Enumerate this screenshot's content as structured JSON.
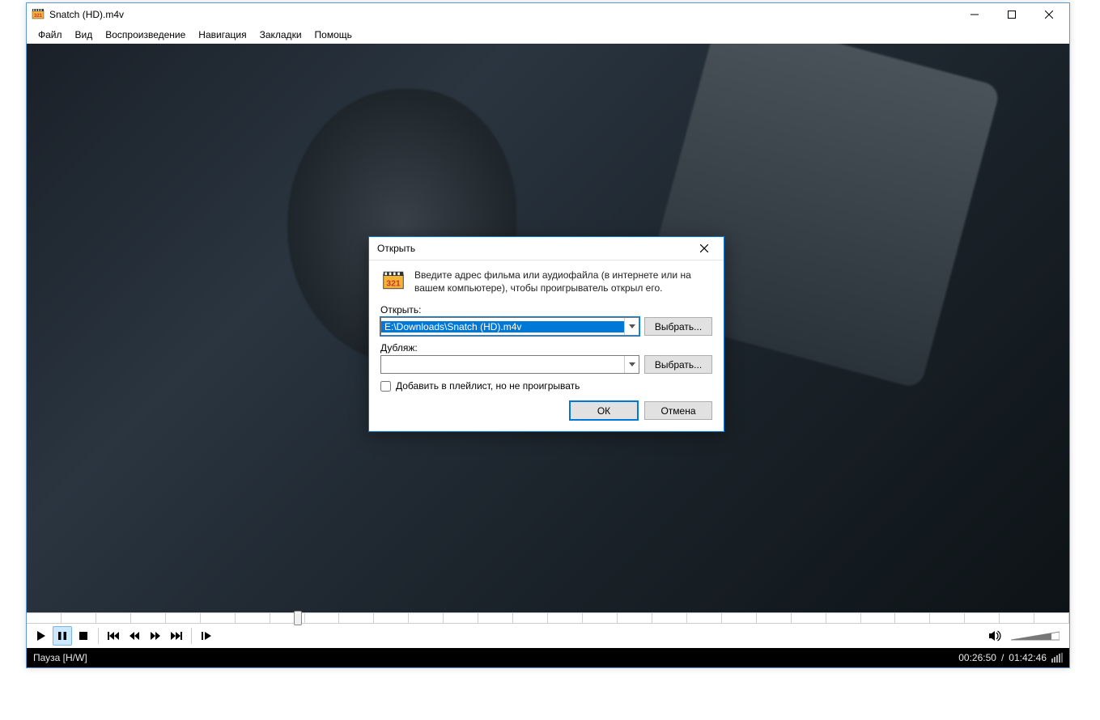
{
  "window": {
    "title": "Snatch (HD).m4v",
    "controls": {
      "minimize": "—",
      "maximize": "☐",
      "close": "✕"
    }
  },
  "menubar": {
    "items": [
      "Файл",
      "Вид",
      "Воспроизведение",
      "Навигация",
      "Закладки",
      "Помощь"
    ]
  },
  "seek": {
    "progress_percent": 26
  },
  "playback": {
    "play": "play",
    "pause_active": true,
    "stop": "stop",
    "prev": "prev",
    "rewind": "rewind",
    "forward": "forward",
    "next": "next",
    "step": "step"
  },
  "status": {
    "left": "Пауза [H/W]",
    "time_current": "00:26:50",
    "time_sep": " / ",
    "time_total": "01:42:46"
  },
  "dialog": {
    "title": "Открыть",
    "intro": "Введите адрес фильма или аудиофайла (в интернете или на вашем компьютере), чтобы проигрыватель открыл его.",
    "open_label": "Открыть:",
    "open_value": "E:\\Downloads\\Snatch (HD).m4v",
    "dub_label": "Дубляж:",
    "dub_value": "",
    "browse": "Выбрать...",
    "checkbox_label": "Добавить в плейлист, но не проигрывать",
    "checkbox_checked": false,
    "ok": "ОК",
    "cancel": "Отмена"
  }
}
